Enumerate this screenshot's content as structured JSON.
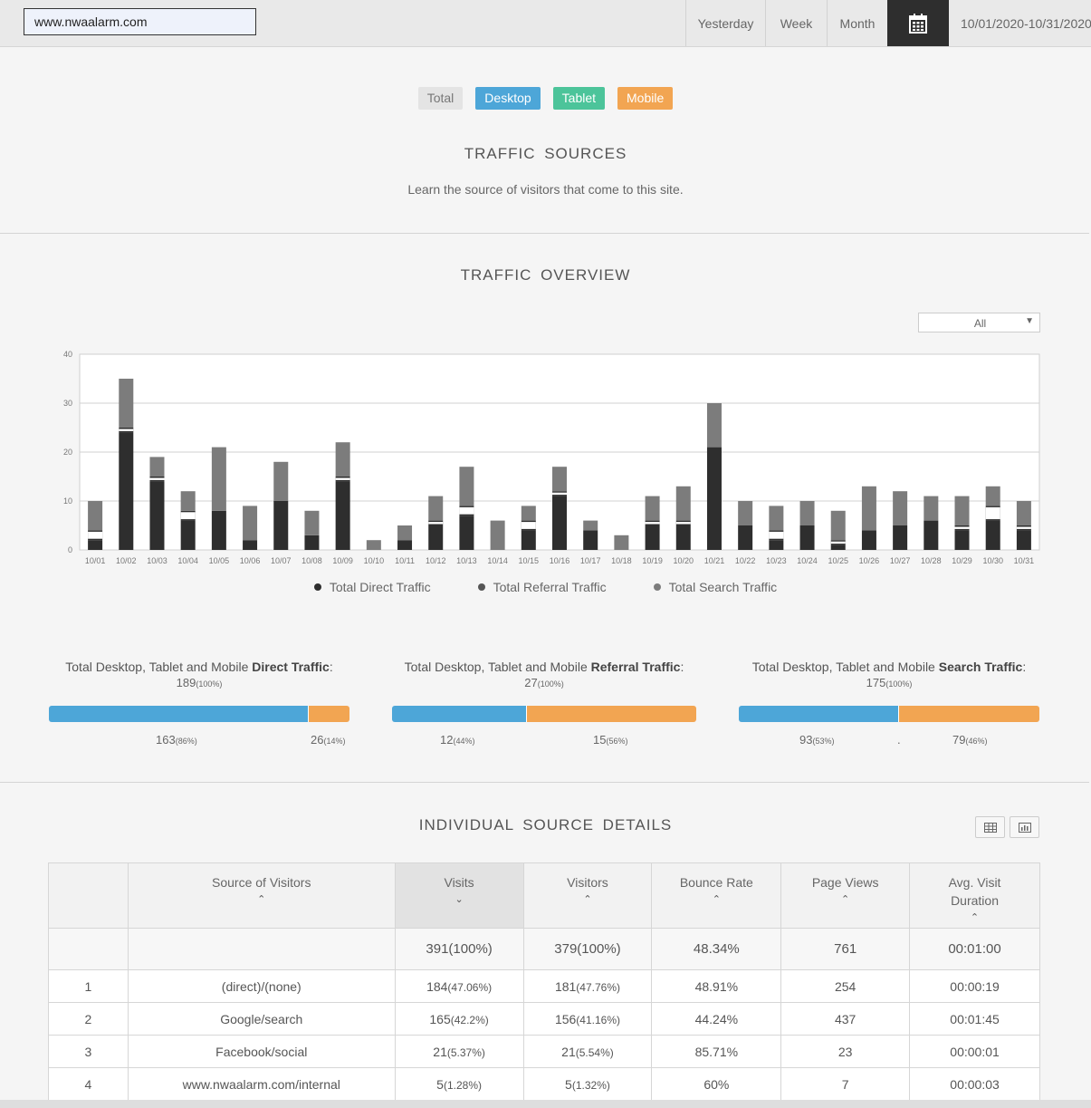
{
  "header": {
    "url": "www.nwaalarm.com",
    "ranges": [
      "Yesterday",
      "Week",
      "Month"
    ],
    "calendar_icon": "calendar-icon",
    "date_range": "10/01/2020-10/31/2020"
  },
  "device_tabs": [
    "Total",
    "Desktop",
    "Tablet",
    "Mobile"
  ],
  "colors": {
    "desktop": "#4da6d8",
    "tablet": "#4cc49a",
    "mobile": "#f2a552",
    "direct": "#2e2e2e",
    "referral": "#f5f5f5",
    "search": "#7c7c7c"
  },
  "traffic_sources": {
    "title": "TRAFFIC SOURCES",
    "subtitle": "Learn the source of visitors that come to this site."
  },
  "overview": {
    "title": "TRAFFIC OVERVIEW",
    "filter_value": "All"
  },
  "chart_data": {
    "type": "bar",
    "stacked": true,
    "categories": [
      "10/01",
      "10/02",
      "10/03",
      "10/04",
      "10/05",
      "10/06",
      "10/07",
      "10/08",
      "10/09",
      "10/10",
      "10/11",
      "10/12",
      "10/13",
      "10/14",
      "10/15",
      "10/16",
      "10/17",
      "10/18",
      "10/19",
      "10/20",
      "10/21",
      "10/22",
      "10/23",
      "10/24",
      "10/25",
      "10/26",
      "10/27",
      "10/28",
      "10/29",
      "10/30",
      "10/31"
    ],
    "series": [
      {
        "name": "Total Direct Traffic",
        "values": [
          2,
          24,
          14,
          6,
          8,
          2,
          10,
          3,
          14,
          0,
          2,
          5,
          7,
          0,
          4,
          11,
          4,
          0,
          5,
          5,
          21,
          5,
          2,
          5,
          1,
          4,
          5,
          6,
          4,
          6,
          4
        ]
      },
      {
        "name": "Total Referral Traffic",
        "values": [
          2,
          1,
          1,
          2,
          0,
          0,
          0,
          0,
          1,
          0,
          0,
          1,
          2,
          0,
          2,
          1,
          0,
          0,
          1,
          1,
          0,
          0,
          2,
          0,
          1,
          0,
          0,
          0,
          1,
          3,
          1
        ]
      },
      {
        "name": "Total Search Traffic",
        "values": [
          6,
          10,
          4,
          4,
          13,
          7,
          8,
          5,
          7,
          2,
          3,
          5,
          8,
          6,
          3,
          5,
          2,
          3,
          5,
          7,
          9,
          5,
          5,
          5,
          6,
          9,
          7,
          5,
          6,
          4,
          5
        ]
      }
    ],
    "ylim": [
      0,
      40
    ],
    "yticks": [
      0,
      10,
      20,
      30,
      40
    ],
    "grid": true,
    "legend": "bottom"
  },
  "totals": [
    {
      "prefix": "Total Desktop, Tablet and Mobile ",
      "bold": "Direct Traffic",
      "suffix": ":",
      "value": "189",
      "pct": "(100%)",
      "desktop_value": "163",
      "desktop_pct": "(86%)",
      "desktop_share": 0.86,
      "tablet_value": "",
      "mobile_value": "26",
      "mobile_pct": "(14%)"
    },
    {
      "prefix": "Total Desktop, Tablet and Mobile ",
      "bold": "Referral Traffic",
      "suffix": ":",
      "value": "27",
      "pct": "(100%)",
      "desktop_value": "12",
      "desktop_pct": "(44%)",
      "desktop_share": 0.44,
      "tablet_value": "",
      "mobile_value": "15",
      "mobile_pct": "(56%)"
    },
    {
      "prefix": "Total Desktop, Tablet and Mobile ",
      "bold": "Search Traffic",
      "suffix": ":",
      "value": "175",
      "pct": "(100%)",
      "desktop_value": "93",
      "desktop_pct": "(53%)",
      "desktop_share": 0.53,
      "tablet_value": ".",
      "mobile_value": "79",
      "mobile_pct": "(46%)"
    }
  ],
  "details": {
    "title": "INDIVIDUAL SOURCE DETAILS",
    "view_icons": [
      "table-view-icon",
      "chart-view-icon"
    ],
    "columns": [
      "",
      "Source of Visitors",
      "Visits",
      "Visitors",
      "Bounce Rate",
      "Page Views",
      "Avg. Visit Duration"
    ],
    "sort_arrows": [
      "",
      "⌃",
      "⌄",
      "⌃",
      "⌃",
      "⌃",
      "⌃"
    ],
    "summary": {
      "visits": "391(100%)",
      "visitors": "379(100%)",
      "bounce": "48.34%",
      "pageviews": "761",
      "duration": "00:01:00"
    },
    "rows": [
      {
        "n": "1",
        "source": "(direct)/(none)",
        "visits": "184",
        "visits_pct": "(47.06%)",
        "visitors": "181",
        "visitors_pct": "(47.76%)",
        "bounce": "48.91%",
        "pageviews": "254",
        "duration": "00:00:19"
      },
      {
        "n": "2",
        "source": "Google/search",
        "visits": "165",
        "visits_pct": "(42.2%)",
        "visitors": "156",
        "visitors_pct": "(41.16%)",
        "bounce": "44.24%",
        "pageviews": "437",
        "duration": "00:01:45"
      },
      {
        "n": "3",
        "source": "Facebook/social",
        "visits": "21",
        "visits_pct": "(5.37%)",
        "visitors": "21",
        "visitors_pct": "(5.54%)",
        "bounce": "85.71%",
        "pageviews": "23",
        "duration": "00:00:01"
      },
      {
        "n": "4",
        "source": "www.nwaalarm.com/internal",
        "visits": "5",
        "visits_pct": "(1.28%)",
        "visitors": "5",
        "visitors_pct": "(1.32%)",
        "bounce": "60%",
        "pageviews": "7",
        "duration": "00:00:03"
      }
    ]
  }
}
